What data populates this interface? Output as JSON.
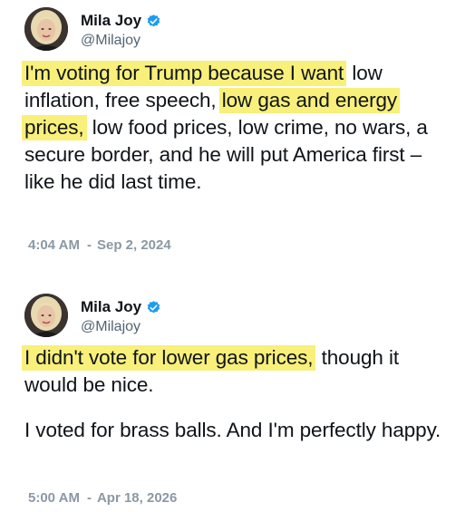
{
  "tweets": [
    {
      "author": {
        "display_name": "Mila Joy",
        "handle": "@Milajoy",
        "verified": true,
        "avatar_icon": "avatar-photo"
      },
      "body": {
        "hl_1": "I'm voting for Trump because I want",
        "text_1": "low inflation, free speech,",
        "hl_2": "low gas and energy prices,",
        "text_2": "low food prices, low crime, no wars, a secure border, and he will put America first – like he did last time."
      },
      "time": "4:04 AM",
      "separator": "-",
      "date": "Sep 2, 2024"
    },
    {
      "author": {
        "display_name": "Mila Joy",
        "handle": "@Milajoy",
        "verified": true,
        "avatar_icon": "avatar-photo"
      },
      "body": {
        "hl_1": "I didn't vote for lower gas prices,",
        "text_1": "though it would be nice.",
        "para_2": "I voted for brass balls. And I'm perfectly happy."
      },
      "time": "5:00 AM",
      "separator": "-",
      "date": "Apr 18, 2026"
    }
  ],
  "colors": {
    "highlight": "#f8f07a",
    "verified_badge": "#1d9bf0",
    "handle": "#536471",
    "timestamp": "#8b98a5"
  }
}
